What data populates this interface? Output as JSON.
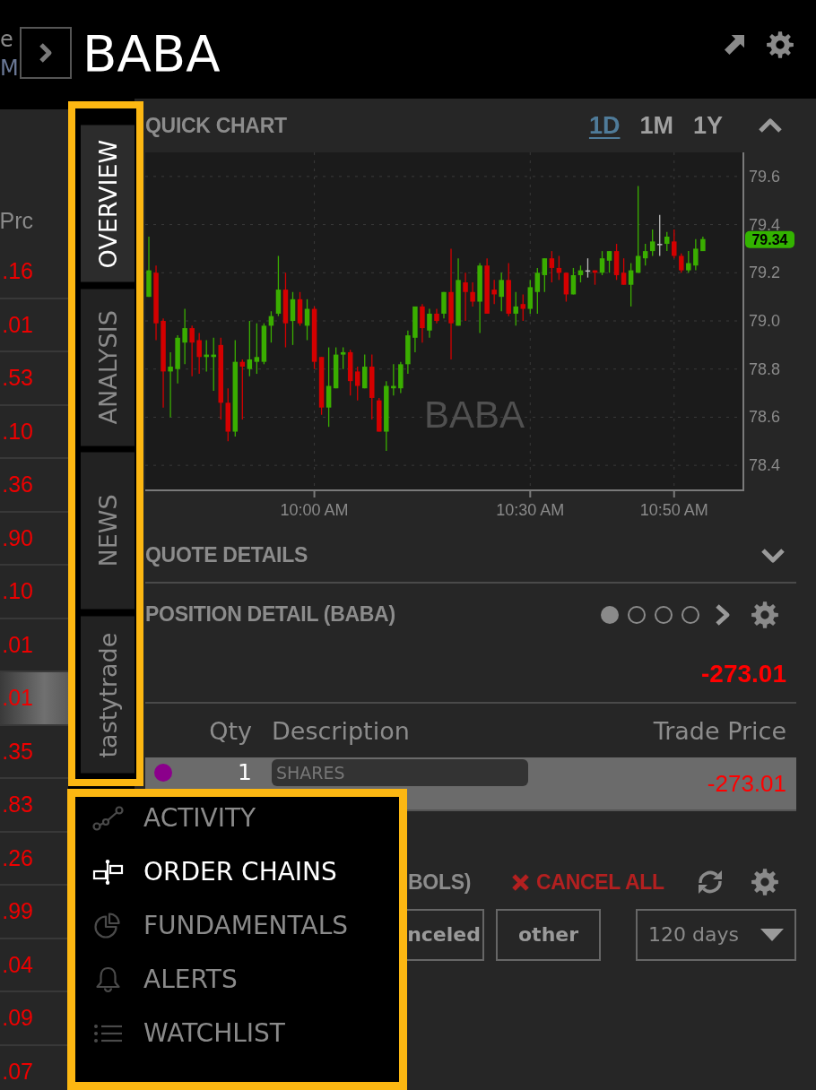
{
  "header": {
    "cut_off_labels": [
      "e",
      "M"
    ],
    "symbol": "BABA"
  },
  "watchlist": {
    "column_header": "Prc",
    "rows": [
      {
        "price": ".16",
        "selected": false
      },
      {
        "price": ".01",
        "selected": false
      },
      {
        "price": ".53",
        "selected": false
      },
      {
        "price": ".10",
        "selected": false
      },
      {
        "price": ".36",
        "selected": false
      },
      {
        "price": ".90",
        "selected": false
      },
      {
        "price": ".10",
        "selected": false
      },
      {
        "price": ".01",
        "selected": false
      },
      {
        "price": ".01",
        "selected": true
      },
      {
        "price": ".35",
        "selected": false
      },
      {
        "price": ".83",
        "selected": false
      },
      {
        "price": ".26",
        "selected": false
      },
      {
        "price": ".99",
        "selected": false
      },
      {
        "price": ".04",
        "selected": false
      },
      {
        "price": ".09",
        "selected": false
      },
      {
        "price": ".07",
        "selected": false
      }
    ]
  },
  "side_tabs": {
    "highlighted": true,
    "tabs": [
      {
        "label": "OVERVIEW",
        "selected": true
      },
      {
        "label": "ANALYSIS",
        "selected": false
      },
      {
        "label": "NEWS",
        "selected": false
      },
      {
        "label": "tastytrade",
        "selected": false
      }
    ]
  },
  "quick_chart": {
    "title": "QUICK CHART",
    "ranges": [
      {
        "label": "1D",
        "selected": true
      },
      {
        "label": "1M",
        "selected": false
      },
      {
        "label": "1Y",
        "selected": false
      }
    ],
    "expanded": true,
    "watermark": "BABA",
    "last_price": "79.34",
    "chart_data": {
      "type": "candlestick",
      "grid": true,
      "categories": [
        null,
        null,
        null,
        null,
        null,
        null,
        null,
        null,
        null,
        null,
        null,
        null,
        null,
        null,
        null,
        null,
        null,
        null,
        null,
        null,
        null,
        null,
        null,
        "10:00 AM",
        null,
        null,
        null,
        null,
        null,
        null,
        null,
        null,
        null,
        null,
        null,
        null,
        null,
        null,
        null,
        null,
        null,
        null,
        null,
        null,
        null,
        null,
        null,
        null,
        null,
        null,
        null,
        null,
        null,
        "10:30 AM",
        null,
        null,
        null,
        null,
        null,
        null,
        null,
        null,
        null,
        null,
        null,
        null,
        null,
        null,
        null,
        null,
        null,
        null,
        null,
        "10:50 AM",
        null,
        null,
        null,
        null,
        null,
        null,
        null,
        null,
        null
      ],
      "ohlc": [
        [
          79.1,
          79.35,
          79.1,
          79.21
        ],
        [
          79.2,
          79.23,
          78.92,
          78.99
        ],
        [
          79.0,
          79.01,
          78.64,
          78.79
        ],
        [
          78.79,
          78.87,
          78.6,
          78.81
        ],
        [
          78.8,
          78.94,
          78.74,
          78.93
        ],
        [
          78.91,
          79.05,
          78.82,
          78.97
        ],
        [
          78.97,
          78.98,
          78.77,
          78.91
        ],
        [
          78.92,
          78.95,
          78.78,
          78.85
        ],
        [
          78.85,
          78.92,
          78.79,
          78.86
        ],
        [
          78.85,
          78.93,
          78.71,
          78.86
        ],
        [
          78.9,
          78.93,
          78.59,
          78.66
        ],
        [
          78.66,
          78.72,
          78.5,
          78.54
        ],
        [
          78.54,
          78.92,
          78.52,
          78.83
        ],
        [
          78.83,
          78.84,
          78.59,
          78.81
        ],
        [
          78.8,
          79.0,
          78.77,
          78.84
        ],
        [
          78.83,
          78.99,
          78.78,
          78.85
        ],
        [
          78.83,
          78.99,
          78.82,
          78.98
        ],
        [
          78.98,
          79.04,
          78.91,
          79.02
        ],
        [
          79.03,
          79.27,
          79.02,
          79.13
        ],
        [
          79.13,
          79.2,
          78.89,
          78.99
        ],
        [
          79.0,
          79.12,
          78.9,
          79.09
        ],
        [
          79.09,
          79.12,
          78.98,
          78.99
        ],
        [
          78.98,
          79.09,
          78.92,
          79.05
        ],
        [
          79.05,
          79.06,
          78.8,
          78.83
        ],
        [
          78.85,
          78.85,
          78.61,
          78.64
        ],
        [
          78.64,
          78.89,
          78.56,
          78.73
        ],
        [
          78.72,
          78.89,
          78.72,
          78.86
        ],
        [
          78.86,
          78.89,
          78.8,
          78.87
        ],
        [
          78.87,
          78.88,
          78.69,
          78.75
        ],
        [
          78.79,
          78.81,
          78.67,
          78.73
        ],
        [
          78.72,
          78.86,
          78.72,
          78.81
        ],
        [
          78.81,
          78.86,
          78.59,
          78.68
        ],
        [
          78.67,
          78.68,
          78.54,
          78.54
        ],
        [
          78.54,
          78.75,
          78.46,
          78.73
        ],
        [
          78.72,
          78.82,
          78.69,
          78.73
        ],
        [
          78.72,
          78.83,
          78.7,
          78.82
        ],
        [
          78.82,
          78.96,
          78.78,
          78.94
        ],
        [
          78.93,
          79.06,
          78.87,
          79.06
        ],
        [
          79.06,
          79.07,
          78.91,
          78.97
        ],
        [
          78.96,
          79.05,
          78.93,
          79.03
        ],
        [
          79.03,
          79.05,
          78.99,
          79.0
        ],
        [
          79.03,
          79.12,
          79.01,
          79.12
        ],
        [
          79.12,
          79.3,
          78.84,
          78.99
        ],
        [
          78.98,
          79.26,
          78.98,
          79.17
        ],
        [
          79.16,
          79.2,
          79.0,
          79.12
        ],
        [
          79.12,
          79.16,
          79.06,
          79.08
        ],
        [
          79.08,
          79.24,
          78.95,
          79.23
        ],
        [
          79.23,
          79.26,
          79.03,
          79.03
        ],
        [
          79.13,
          79.17,
          79.07,
          79.11
        ],
        [
          79.1,
          79.2,
          79.04,
          79.17
        ],
        [
          79.17,
          79.24,
          79.02,
          79.03
        ],
        [
          79.03,
          79.12,
          78.98,
          79.06
        ],
        [
          79.07,
          79.11,
          79.0,
          79.05
        ],
        [
          79.05,
          79.17,
          79.03,
          79.14
        ],
        [
          79.12,
          79.22,
          79.03,
          79.2
        ],
        [
          79.19,
          79.26,
          79.12,
          79.26
        ],
        [
          79.26,
          79.29,
          79.16,
          79.22
        ],
        [
          79.22,
          79.27,
          79.17,
          79.2
        ],
        [
          79.2,
          79.2,
          79.08,
          79.11
        ],
        [
          79.11,
          79.22,
          79.11,
          79.19
        ],
        [
          79.19,
          79.23,
          79.16,
          79.21
        ],
        [
          79.21,
          79.26,
          79.18,
          79.21
        ],
        [
          79.21,
          79.21,
          79.15,
          79.2
        ],
        [
          79.2,
          79.29,
          79.19,
          79.26
        ],
        [
          79.25,
          79.29,
          79.2,
          79.29
        ],
        [
          79.29,
          79.32,
          79.17,
          79.19
        ],
        [
          79.2,
          79.26,
          79.15,
          79.15
        ],
        [
          79.15,
          79.24,
          79.06,
          79.21
        ],
        [
          79.2,
          79.56,
          79.2,
          79.27
        ],
        [
          79.26,
          79.32,
          79.23,
          79.29
        ],
        [
          79.29,
          79.38,
          79.27,
          79.33
        ],
        [
          79.32,
          79.44,
          79.27,
          79.32
        ],
        [
          79.32,
          79.37,
          79.29,
          79.35
        ],
        [
          79.33,
          79.38,
          79.26,
          79.27
        ],
        [
          79.27,
          79.28,
          79.2,
          79.21
        ],
        [
          79.21,
          79.29,
          79.2,
          79.24
        ],
        [
          79.23,
          79.34,
          79.21,
          79.3
        ],
        [
          79.29,
          79.35,
          79.29,
          79.34
        ],
        null,
        null,
        null,
        null,
        null
      ],
      "ylim": [
        78.3,
        79.7
      ],
      "yticks": [
        {
          "value": 79.6,
          "label": "79.6"
        },
        {
          "value": 79.4,
          "label": "79.4"
        },
        {
          "value": 79.2,
          "label": "79.2"
        },
        {
          "value": 79.0,
          "label": "79.0"
        },
        {
          "value": 78.8,
          "label": "78.8"
        },
        {
          "value": 78.6,
          "label": "78.6"
        },
        {
          "value": 78.4,
          "label": "78.4"
        }
      ]
    }
  },
  "quote_details": {
    "title": "QUOTE DETAILS",
    "expanded": false
  },
  "position_detail": {
    "title": "POSITION DETAIL (BABA)",
    "pages": [
      {
        "selected": true
      },
      {
        "selected": false
      },
      {
        "selected": false
      },
      {
        "selected": false
      }
    ],
    "total": "-273.01",
    "columns": [
      "Qty",
      "Description",
      "Trade Price"
    ],
    "rows": [
      {
        "color": "#8b008b",
        "qty": "1",
        "description": "SHARES",
        "trade_price": "-273.01",
        "selected": true
      }
    ]
  },
  "orders": {
    "title": "BOLS)",
    "cancel_all": "CANCEL ALL",
    "filters": [
      {
        "label": "nceled",
        "selected": false
      },
      {
        "label": "other",
        "selected": false
      }
    ],
    "period": "120 days"
  },
  "menu": {
    "highlighted": true,
    "items": [
      {
        "kind": "activity",
        "label": "ACTIVITY",
        "selected": false
      },
      {
        "kind": "chains",
        "label": "ORDER CHAINS",
        "selected": true
      },
      {
        "kind": "fundamentals",
        "label": "FUNDAMENTALS",
        "selected": false
      },
      {
        "kind": "alerts",
        "label": "ALERTS",
        "selected": false
      },
      {
        "kind": "watchlist",
        "label": "WATCHLIST",
        "selected": false
      }
    ]
  }
}
